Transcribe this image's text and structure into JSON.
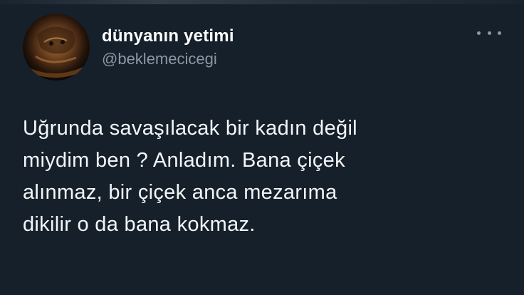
{
  "author": {
    "display_name": "dünyanın yetimi",
    "handle": "@beklemecicegi",
    "avatar_icon": "profile-photo"
  },
  "menu": {
    "icon": "more-horizontal-icon"
  },
  "tweet": {
    "lines": [
      "Uğrunda savaşılacak bir kadın değil",
      "miydim ben ? Anladım. Bana çiçek",
      "alınmaz, bir çiçek anca mezarıma",
      "dikilir o da bana kokmaz."
    ]
  },
  "colors": {
    "background": "#15202b",
    "text": "#ffffff",
    "secondary": "#8b98a5"
  }
}
